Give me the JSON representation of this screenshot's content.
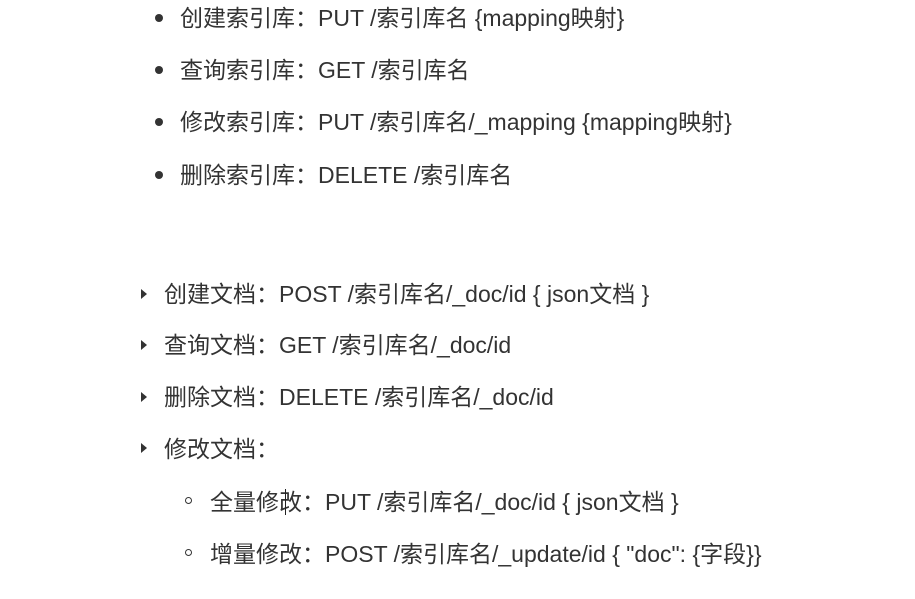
{
  "index_ops": [
    "创建索引库：PUT /索引库名 {mapping映射}",
    "查询索引库：GET /索引库名",
    "修改索引库：PUT /索引库名/_mapping {mapping映射}",
    "删除索引库：DELETE /索引库名"
  ],
  "doc_ops": [
    "创建文档：POST /索引库名/_doc/id   { json文档 }",
    "查询文档：GET /索引库名/_doc/id",
    "删除文档：DELETE /索引库名/_doc/id",
    "修改文档："
  ],
  "doc_modify_subops": [
    "全量修改：PUT /索引库名/_doc/id { json文档 }",
    "增量修改：POST /索引库名/_update/id { \"doc\": {字段}}"
  ]
}
